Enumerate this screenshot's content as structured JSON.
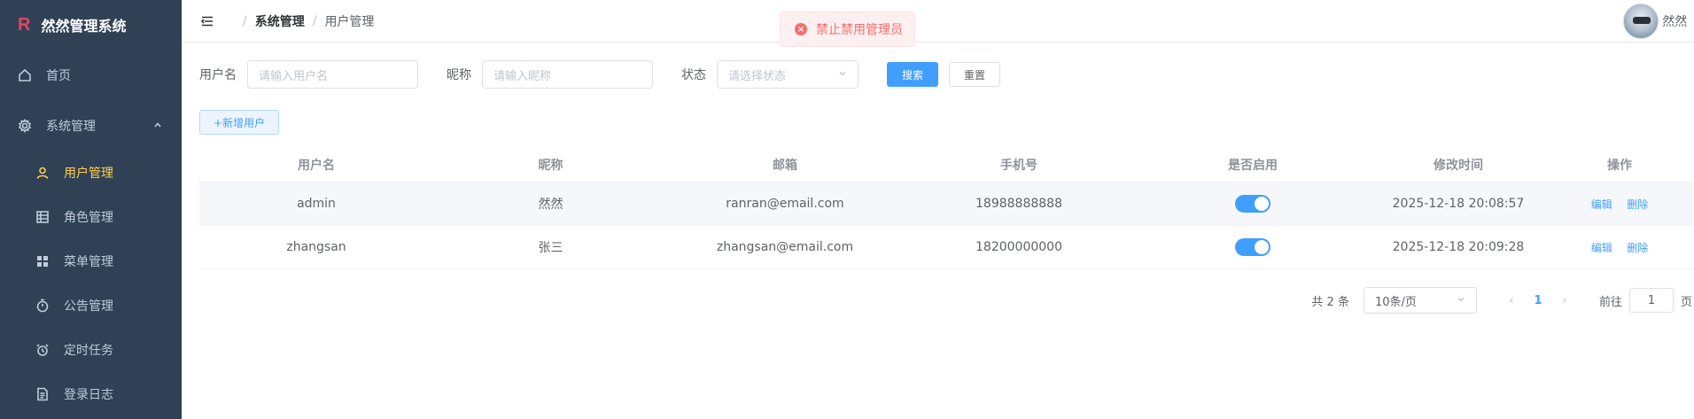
{
  "app": {
    "logo_mark": "R",
    "title": "然然管理系统"
  },
  "sidebar": {
    "items": [
      {
        "label": "首页",
        "icon": "home-icon"
      },
      {
        "label": "系统管理",
        "icon": "gear-icon",
        "expanded": true
      }
    ],
    "sub_items": [
      {
        "label": "用户管理",
        "icon": "user-icon",
        "active": true
      },
      {
        "label": "角色管理",
        "icon": "grid-icon"
      },
      {
        "label": "菜单管理",
        "icon": "menu-squares-icon"
      },
      {
        "label": "公告管理",
        "icon": "timer-icon"
      },
      {
        "label": "定时任务",
        "icon": "alarm-clock-icon"
      },
      {
        "label": "登录日志",
        "icon": "document-icon"
      }
    ]
  },
  "breadcrumb": {
    "items": [
      "系统管理",
      "用户管理"
    ]
  },
  "user": {
    "name": "然然"
  },
  "toast": {
    "message": "禁止禁用管理员",
    "type": "error"
  },
  "search": {
    "username_label": "用户名",
    "username_placeholder": "请输入用户名",
    "nickname_label": "昵称",
    "nickname_placeholder": "请输入昵称",
    "status_label": "状态",
    "status_placeholder": "请选择状态",
    "search_button": "搜索",
    "reset_button": "重置"
  },
  "toolbar": {
    "add_button": "+新增用户"
  },
  "table": {
    "columns": [
      "用户名",
      "昵称",
      "邮箱",
      "手机号",
      "是否启用",
      "修改时间",
      "操作"
    ],
    "rows": [
      {
        "username": "admin",
        "nickname": "然然",
        "email": "ranran@email.com",
        "phone": "18988888888",
        "enabled": true,
        "updated": "2025-12-18 20:08:57"
      },
      {
        "username": "zhangsan",
        "nickname": "张三",
        "email": "zhangsan@email.com",
        "phone": "18200000000",
        "enabled": true,
        "updated": "2025-12-18 20:09:28"
      }
    ],
    "edit_label": "编辑",
    "delete_label": "删除"
  },
  "pagination": {
    "total_text": "共 2 条",
    "page_size": "10条/页",
    "current_page": "1",
    "goto_label": "前往",
    "goto_value": "1",
    "page_unit": "页"
  },
  "colors": {
    "sidebar_bg": "#304156",
    "active": "#ffd04b",
    "primary": "#409eff",
    "danger": "#f56c6c"
  }
}
